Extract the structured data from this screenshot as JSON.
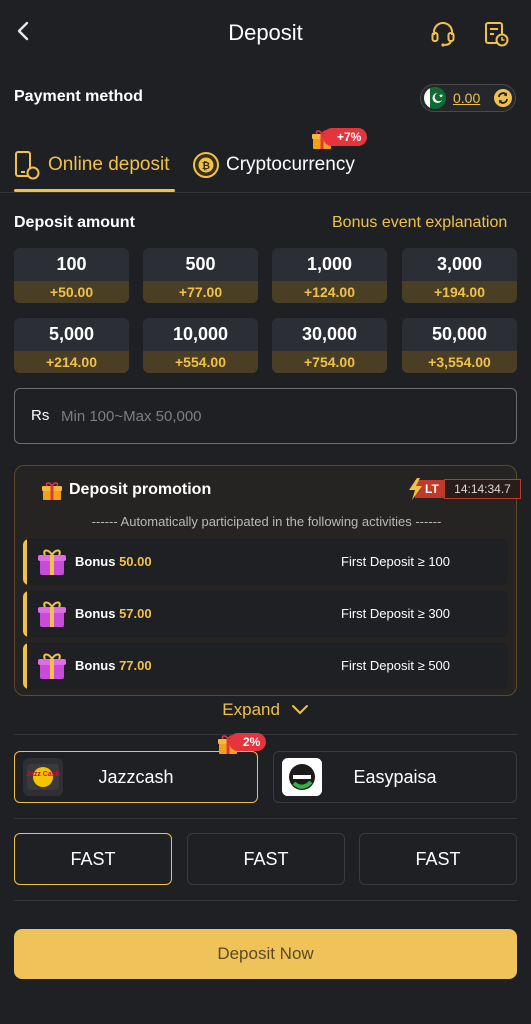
{
  "header": {
    "title": "Deposit"
  },
  "payment": {
    "label": "Payment method",
    "balance": "0.00"
  },
  "tabs": [
    {
      "label": "Online deposit"
    },
    {
      "label": "Cryptocurrency",
      "badge": "+7%"
    }
  ],
  "deposit": {
    "label": "Deposit amount",
    "bonus_link": "Bonus event explanation",
    "amounts": [
      {
        "value": "100",
        "bonus": "+50.00"
      },
      {
        "value": "500",
        "bonus": "+77.00"
      },
      {
        "value": "1,000",
        "bonus": "+124.00"
      },
      {
        "value": "3,000",
        "bonus": "+194.00"
      },
      {
        "value": "5,000",
        "bonus": "+214.00"
      },
      {
        "value": "10,000",
        "bonus": "+554.00"
      },
      {
        "value": "30,000",
        "bonus": "+754.00"
      },
      {
        "value": "50,000",
        "bonus": "+3,554.00"
      }
    ],
    "currency": "Rs",
    "placeholder": "Min 100~Max 50,000"
  },
  "promotion": {
    "title": "Deposit promotion",
    "lt_label": "LT",
    "timer": "14:14:34.7",
    "subtitle": "------ Automatically participated in the following activities ------",
    "items": [
      {
        "bonus_word": "Bonus",
        "bonus_amount": "50.00",
        "condition": "First Deposit ≥ 100"
      },
      {
        "bonus_word": "Bonus",
        "bonus_amount": "57.00",
        "condition": "First Deposit ≥ 300"
      },
      {
        "bonus_word": "Bonus",
        "bonus_amount": "77.00",
        "condition": "First Deposit ≥ 500"
      }
    ],
    "expand_label": "Expand"
  },
  "wallets": [
    {
      "name": "Jazzcash",
      "badge": "2%",
      "logo_text": "Jazz Cash"
    },
    {
      "name": "Easypaisa"
    }
  ],
  "channels": [
    {
      "label": "FAST"
    },
    {
      "label": "FAST"
    },
    {
      "label": "FAST"
    }
  ],
  "cta": {
    "label": "Deposit Now"
  },
  "colors": {
    "accent": "#f0c14b",
    "background": "#1f2023",
    "cta": "#f0c35a",
    "badge": "#e5353c"
  }
}
